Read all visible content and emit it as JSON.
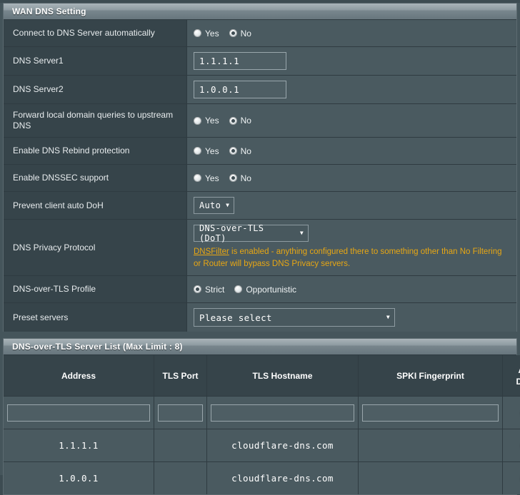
{
  "wan_dns": {
    "title": "WAN DNS Setting",
    "rows": {
      "auto_connect": {
        "label": "Connect to DNS Server automatically",
        "yes": "Yes",
        "no": "No",
        "selected": "No"
      },
      "dns_server1": {
        "label": "DNS Server1",
        "value": "1.1.1.1"
      },
      "dns_server2": {
        "label": "DNS Server2",
        "value": "1.0.0.1"
      },
      "forward_local": {
        "label": "Forward local domain queries to upstream DNS",
        "yes": "Yes",
        "no": "No",
        "selected": "No"
      },
      "rebind": {
        "label": "Enable DNS Rebind protection",
        "yes": "Yes",
        "no": "No",
        "selected": "No"
      },
      "dnssec": {
        "label": "Enable DNSSEC support",
        "yes": "Yes",
        "no": "No",
        "selected": "No"
      },
      "prevent_doh": {
        "label": "Prevent client auto DoH",
        "value": "Auto"
      },
      "privacy_protocol": {
        "label": "DNS Privacy Protocol",
        "value": "DNS-over-TLS (DoT)",
        "note_link": "DNSFilter",
        "note_text": " is enabled - anything configured there to something other than No Filtering or Router will bypass DNS Privacy servers."
      },
      "tls_profile": {
        "label": "DNS-over-TLS Profile",
        "strict": "Strict",
        "opportunistic": "Opportunistic",
        "selected": "Strict"
      },
      "preset_servers": {
        "label": "Preset servers",
        "value": "Please select"
      }
    }
  },
  "server_list": {
    "title": "DNS-over-TLS Server List (Max Limit : 8)",
    "columns": {
      "address": "Address",
      "port": "TLS Port",
      "hostname": "TLS Hostname",
      "spki": "SPKI Fingerprint",
      "adddel_line1": "Add /",
      "adddel_line2": "Delete"
    },
    "new_row": {
      "address": "",
      "port": "",
      "hostname": "",
      "spki": ""
    },
    "rows": [
      {
        "address": "1.1.1.1",
        "port": "",
        "hostname": "cloudflare-dns.com",
        "spki": ""
      },
      {
        "address": "1.0.0.1",
        "port": "",
        "hostname": "cloudflare-dns.com",
        "spki": ""
      }
    ]
  },
  "colors": {
    "panel_bg": "#3a474d",
    "label_bg": "#36444a",
    "value_bg": "#4a5a60",
    "warning": "#e8a713",
    "border": "#2f3b41"
  }
}
